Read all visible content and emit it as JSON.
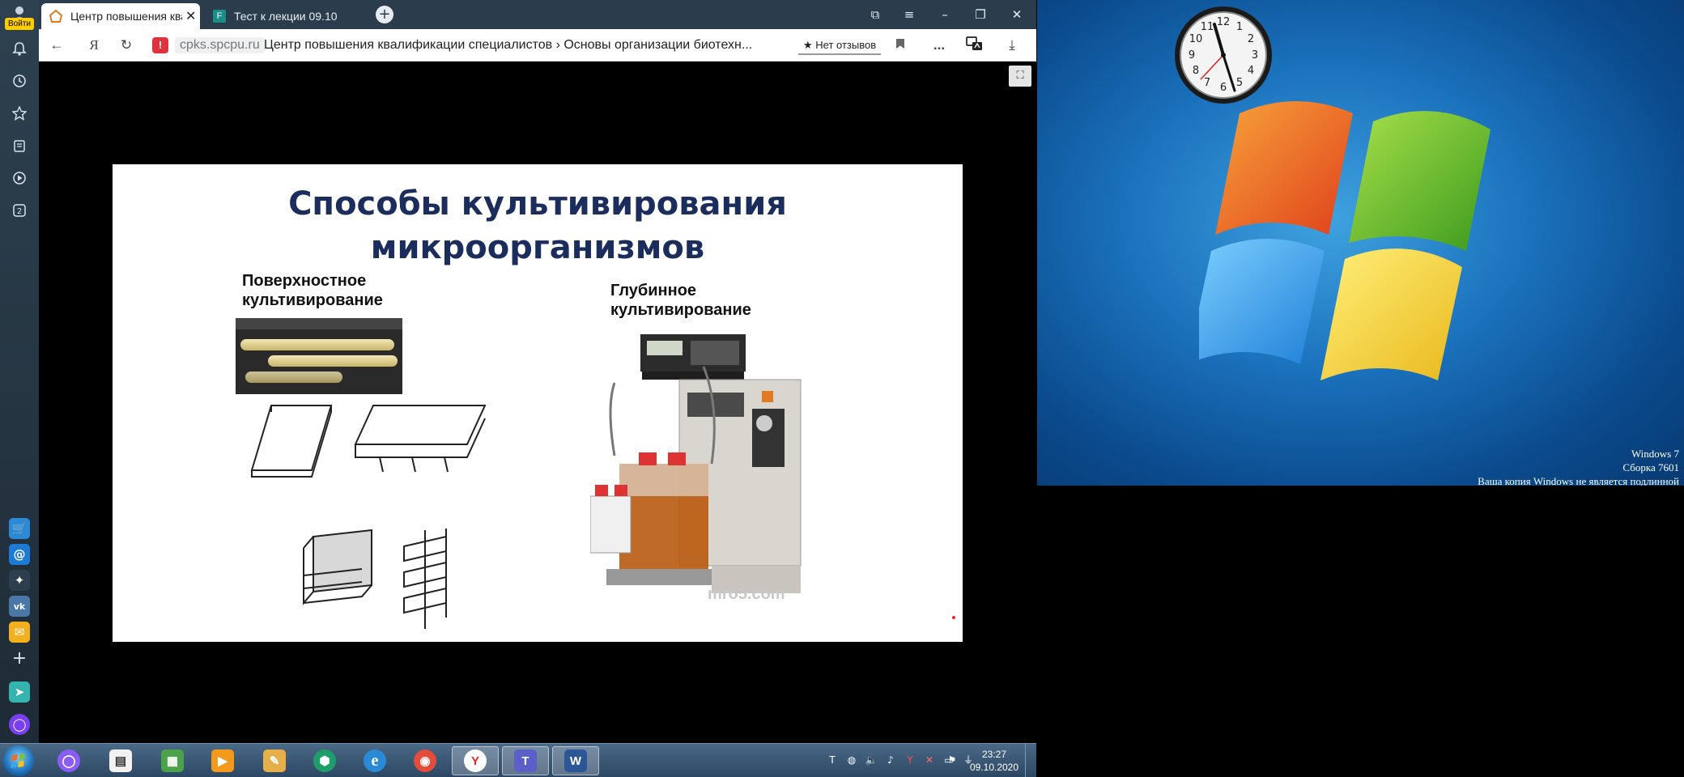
{
  "browser": {
    "login_label": "Войти",
    "tabs": [
      {
        "label": "Центр повышения квалификации",
        "active": true
      },
      {
        "label": "Тест к лекции 09.10",
        "active": false
      }
    ],
    "new_tab_symbol": "+",
    "window_controls": {
      "minimize": "–",
      "maximize": "❐",
      "close": "✕",
      "menu": "≡",
      "bookmarks": "⧉"
    },
    "toolbar": {
      "back": "←",
      "yandex": "Я",
      "reload": "↻",
      "warning": "!",
      "domain": "cpks.spcpu.ru",
      "title": "Центр повышения квалификации специалистов › Основы организации биотехн...",
      "reviews": "★ Нет отзывов",
      "more": "...",
      "download": "⤓"
    }
  },
  "slide": {
    "title_line1": "Способы  культивирования",
    "title_line2": "микроорганизмов",
    "surface_line1": "Поверхностное",
    "surface_line2": "культивирование",
    "deep_line1": "Глубинное",
    "deep_line2": "культивирование",
    "watermark": "mro5.com"
  },
  "desktop": {
    "wm_line1": "Windows 7",
    "wm_line2": "Сборка 7601",
    "wm_line3": "Ваша копия Windows не является подлинной"
  },
  "taskbar": {
    "time": "23:27",
    "date": "09.10.2020",
    "apps": [
      {
        "name": "alice",
        "color": "#8b5cf6",
        "glyph": "◯"
      },
      {
        "name": "notepad",
        "color": "#f2f2f2",
        "glyph": "▤"
      },
      {
        "name": "monitor",
        "color": "#4aa34a",
        "glyph": "▦"
      },
      {
        "name": "media",
        "color": "#f39a1c",
        "glyph": "▶"
      },
      {
        "name": "paint",
        "color": "#e5b04a",
        "glyph": "✎"
      },
      {
        "name": "security",
        "color": "#1e9e6a",
        "glyph": "⬢"
      },
      {
        "name": "ie",
        "color": "#2a8ad8",
        "glyph": "e"
      },
      {
        "name": "chrome",
        "color": "#e44d3a",
        "glyph": "◉"
      },
      {
        "name": "yandex",
        "color": "#ffffff",
        "glyph": "Y"
      },
      {
        "name": "teams",
        "color": "#5b5fc7",
        "glyph": "T"
      },
      {
        "name": "word",
        "color": "#2b5797",
        "glyph": "W"
      }
    ]
  }
}
